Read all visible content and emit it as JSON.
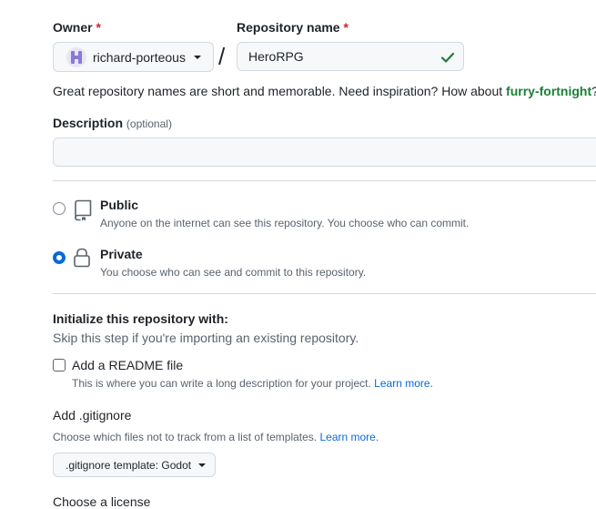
{
  "owner": {
    "label": "Owner",
    "required_mark": "*",
    "selected": "richard-porteous"
  },
  "separator": "/",
  "repo": {
    "label": "Repository name",
    "required_mark": "*",
    "value": "HeroRPG"
  },
  "name_hint": {
    "text": "Great repository names are short and memorable. Need inspiration? How about ",
    "suggestion": "furry-fortnight",
    "end": "?"
  },
  "description": {
    "label": "Description",
    "optional": "(optional)",
    "value": ""
  },
  "visibility": {
    "public": {
      "title": "Public",
      "desc": "Anyone on the internet can see this repository. You choose who can commit.",
      "checked": false
    },
    "private": {
      "title": "Private",
      "desc": "You choose who can see and commit to this repository.",
      "checked": true
    }
  },
  "initialize": {
    "title": "Initialize this repository with:",
    "subtitle": "Skip this step if you're importing an existing repository.",
    "readme": {
      "label": "Add a README file",
      "desc": "This is where you can write a long description for your project.",
      "link": "Learn more.",
      "checked": false
    }
  },
  "gitignore": {
    "title": "Add .gitignore",
    "desc": "Choose which files not to track from a list of templates.",
    "link": "Learn more.",
    "button_label": ".gitignore template: Godot"
  },
  "license": {
    "title": "Choose a license"
  },
  "colors": {
    "accent": "#0969da",
    "success": "#1a7f37",
    "danger": "#cf222e",
    "border": "#d1d9e0"
  }
}
